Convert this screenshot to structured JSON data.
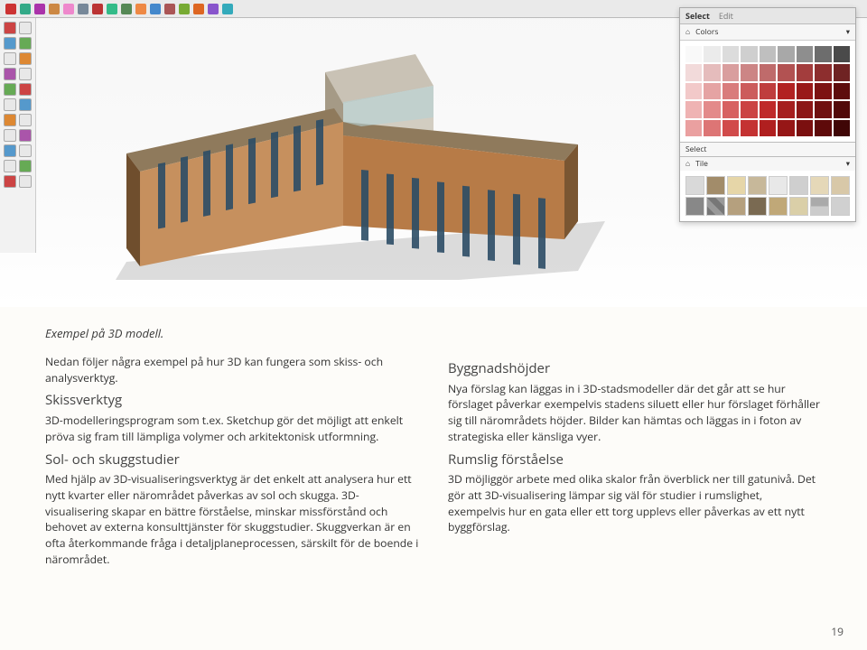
{
  "sketchup_panel": {
    "tab_select": "Select",
    "tab_edit": "Edit",
    "colors_label": "Colors",
    "select_label": "Select",
    "tile_label": "Tile",
    "swatch_colors": [
      "#f9f9f9",
      "#ebebeb",
      "#dcdcdc",
      "#cfcfcf",
      "#bfbfbf",
      "#a8a8a8",
      "#8e8e8e",
      "#6d6d6d",
      "#4a4a4a",
      "#f2dada",
      "#e5bcbc",
      "#d99e9e",
      "#cc8585",
      "#bf6b6b",
      "#b25252",
      "#a33d3d",
      "#8d2e2e",
      "#6f2323",
      "#f2c9c9",
      "#e5a3a3",
      "#d97c7c",
      "#cc5c5c",
      "#bf3d3d",
      "#b22222",
      "#991919",
      "#7d1212",
      "#5e0c0c",
      "#efb3b3",
      "#e38a8a",
      "#d76161",
      "#cb4343",
      "#bf2a2a",
      "#a61f1f",
      "#8c1717",
      "#701010",
      "#520909",
      "#eaa0a0",
      "#dd7575",
      "#d14b4b",
      "#c43232",
      "#b01f1f",
      "#961616",
      "#7b0f0f",
      "#5e0a0a",
      "#3f0606"
    ]
  },
  "caption": "Exempel på 3D modell.",
  "left": {
    "intro": "Nedan följer några exempel på hur 3D kan fungera som skiss- och analysverktyg.",
    "h_skiss": "Skissverktyg",
    "p_skiss": "3D-modelleringsprogram som t.ex. Sketchup gör det möjligt att enkelt pröva sig fram till lämpliga volymer och arkitektonisk utformning.",
    "h_sol": "Sol- och skuggstudier",
    "p_sol": "Med hjälp av 3D-visualiseringsverktyg är det enkelt att analysera hur ett nytt kvarter eller närområdet påverkas av sol och skugga. 3D-visualisering skapar en bättre förståelse, minskar missförstånd och behovet av externa konsulttjänster för skuggstudier. Skuggverkan är en ofta återkommande fråga i detaljplaneprocessen, särskilt för de boende i närområdet."
  },
  "right": {
    "h_bygg": "Byggnadshöjder",
    "p_bygg": "Nya förslag kan läggas in i 3D-stadsmodeller där det går att se hur förslaget påverkar exempelvis stadens siluett eller hur förslaget förhåller sig till närområdets höjder. Bilder kan hämtas och läggas in i foton av strategiska eller känsliga vyer.",
    "h_rum": "Rumslig förståelse",
    "p_rum": "3D möjliggör arbete med olika skalor från överblick ner till gatunivå. Det gör att 3D-visualisering lämpar sig väl för studier i rumslighet, exempelvis hur en gata eller ett torg upplevs eller påverkas av ett nytt byggförslag."
  },
  "pagenum": "19"
}
